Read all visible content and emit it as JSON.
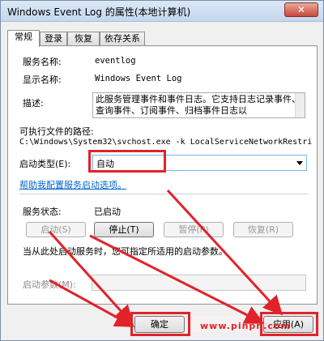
{
  "window": {
    "title": "Windows Event Log 的属性(本地计算机)",
    "close_symbol": "✕"
  },
  "tabs": [
    {
      "label": "常规",
      "active": true
    },
    {
      "label": "登录",
      "active": false
    },
    {
      "label": "恢复",
      "active": false
    },
    {
      "label": "依存关系",
      "active": false
    }
  ],
  "general": {
    "service_name_label": "服务名称:",
    "service_name_value": "eventlog",
    "display_name_label": "显示名称:",
    "display_name_value": "Windows Event Log",
    "description_label": "描述:",
    "description_value": "此服务管理事件和事件日志。它支持日志记录事件、查询事件、订阅事件、归档事件日志以",
    "exe_path_label": "可执行文件的路径:",
    "exe_path_value": "C:\\Windows\\System32\\svchost.exe -k LocalServiceNetworkRestri",
    "startup_type_label": "启动类型(E):",
    "startup_type_value": "自动",
    "help_link": "帮助我配置服务启动选项。",
    "service_status_label": "服务状态:",
    "service_status_value": "已启动",
    "buttons": {
      "start": "启动(S)",
      "stop": "停止(T)",
      "pause": "暂停(P)",
      "resume": "恢复(R)"
    },
    "hint_text": "当从此处启动服务时，您可指定所适用的启动参数。",
    "start_params_label": "启动参数(M):",
    "start_params_value": ""
  },
  "footer": {
    "ok_label": "确定",
    "apply_label": "应用(A)"
  },
  "watermark": "www.pinpn.com",
  "colors": {
    "highlight_red": "#e0232a",
    "link_blue": "#0066cc",
    "accent_border": "#7eb4ea"
  }
}
